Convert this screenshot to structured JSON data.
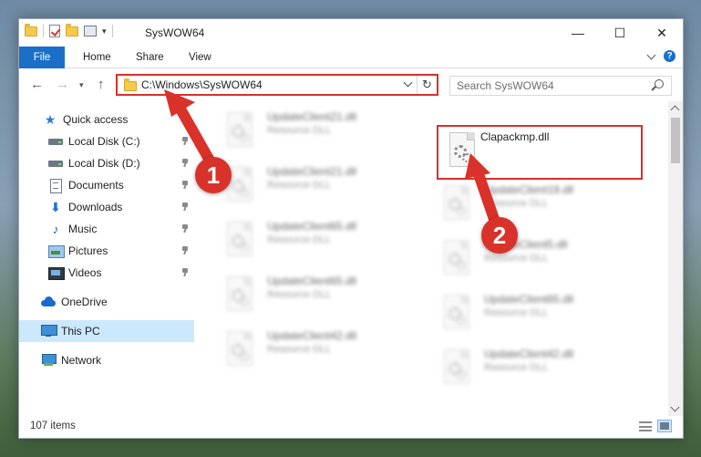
{
  "window": {
    "title": "SysWOW64",
    "controls": {
      "minimize": "—",
      "maximize": "☐",
      "close": "✕"
    }
  },
  "ribbon": {
    "tabs": [
      "File",
      "Home",
      "Share",
      "View"
    ]
  },
  "navigation": {
    "back": "←",
    "forward": "→",
    "recent": "▾",
    "up": "↑"
  },
  "address": {
    "path": "C:\\Windows\\SysWOW64",
    "refresh": "↻"
  },
  "search": {
    "placeholder": "Search SysWOW64"
  },
  "sidebar": {
    "items": [
      {
        "label": "Quick access",
        "icon": "star-icon",
        "pinned": false
      },
      {
        "label": "Local Disk (C:)",
        "icon": "drive-icon",
        "pinned": true
      },
      {
        "label": "Local Disk (D:)",
        "icon": "drive-icon",
        "pinned": true
      },
      {
        "label": "Documents",
        "icon": "documents-icon",
        "pinned": true
      },
      {
        "label": "Downloads",
        "icon": "downloads-icon",
        "pinned": true
      },
      {
        "label": "Music",
        "icon": "music-icon",
        "pinned": true
      },
      {
        "label": "Pictures",
        "icon": "pictures-icon",
        "pinned": true
      },
      {
        "label": "Videos",
        "icon": "videos-icon",
        "pinned": true
      },
      {
        "label": "OneDrive",
        "icon": "onedrive-icon",
        "pinned": false
      },
      {
        "label": "This PC",
        "icon": "this-pc-icon",
        "pinned": false,
        "selected": true
      },
      {
        "label": "Network",
        "icon": "network-icon",
        "pinned": false
      }
    ]
  },
  "files": {
    "left": [
      {
        "name": "UpdateClient21.dll",
        "type": "Resource DLL"
      },
      {
        "name": "UpdateClient21.dll",
        "type": "Resource DLL"
      },
      {
        "name": "UpdateClient65.dll",
        "type": "Resource DLL"
      },
      {
        "name": "UpdateClient65.dll",
        "type": "Resource DLL"
      },
      {
        "name": "UpdateClient42.dll",
        "type": "Resource DLL"
      }
    ],
    "right": [
      {
        "name": "Clapackmp.dll",
        "type": ""
      },
      {
        "name": "UpdateClient19.dll",
        "type": "Resource DLL"
      },
      {
        "name": "UpdateClient5.dll",
        "type": "Resource DLL"
      },
      {
        "name": "UpdateClient65.dll",
        "type": "Resource DLL"
      },
      {
        "name": "UpdateClient42.dll",
        "type": "Resource DLL"
      }
    ]
  },
  "status": {
    "item_count": "107 items"
  },
  "annotations": {
    "step1": "1",
    "step2": "2",
    "color": "#d9322a"
  }
}
